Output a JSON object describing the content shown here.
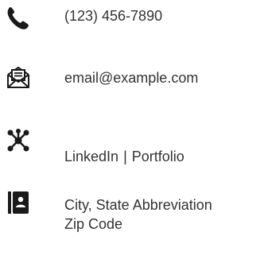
{
  "contact": {
    "phone": {
      "icon": "phone-icon",
      "value": "(123) 456-7890"
    },
    "email": {
      "icon": "envelope-icon",
      "value": "email@example.com"
    },
    "links": {
      "icon": "network-icon",
      "linkedin_label": "LinkedIn",
      "separator": "|",
      "portfolio_label": "Portfolio"
    },
    "address": {
      "icon": "address-book-icon",
      "line1": "City, State Abbreviation",
      "line2": "Zip Code"
    }
  },
  "colors": {
    "icon": "#1a1a1a",
    "text": "#333333"
  }
}
